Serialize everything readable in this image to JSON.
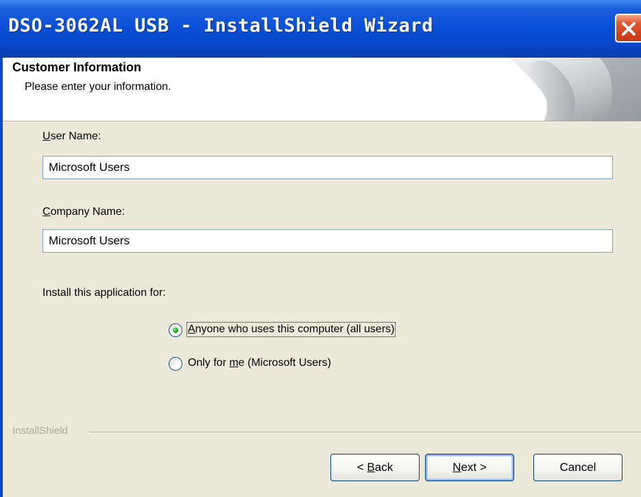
{
  "window": {
    "title": "DSO-3062AL USB - InstallShield Wizard"
  },
  "header": {
    "title": "Customer Information",
    "subtitle": "Please enter your information."
  },
  "form": {
    "user_name_label_pre": "",
    "user_name_label_key": "U",
    "user_name_label_rest": "ser Name:",
    "user_name_value": "Microsoft Users",
    "company_label_key": "C",
    "company_label_rest": "ompany Name:",
    "company_value": "Microsoft Users",
    "install_for_label": "Install this application for:",
    "radio_all_key": "A",
    "radio_all_rest": "nyone who uses this computer (all users)",
    "radio_all_selected": true,
    "radio_me_pre": "Only for ",
    "radio_me_key": "m",
    "radio_me_rest": "e (Microsoft Users)",
    "radio_me_selected": false
  },
  "footer": {
    "brand": "InstallShield",
    "back_pre": "< ",
    "back_key": "B",
    "back_rest": "ack",
    "next_key": "N",
    "next_rest": "ext >",
    "cancel_label": "Cancel"
  },
  "colors": {
    "title_bar": "#0a50d8",
    "dialog_bg": "#ece9d8",
    "close_button": "#d1431d",
    "radio_selected": "#21a121"
  },
  "icons": [
    "close-icon",
    "wizard-page-curl-graphic"
  ]
}
